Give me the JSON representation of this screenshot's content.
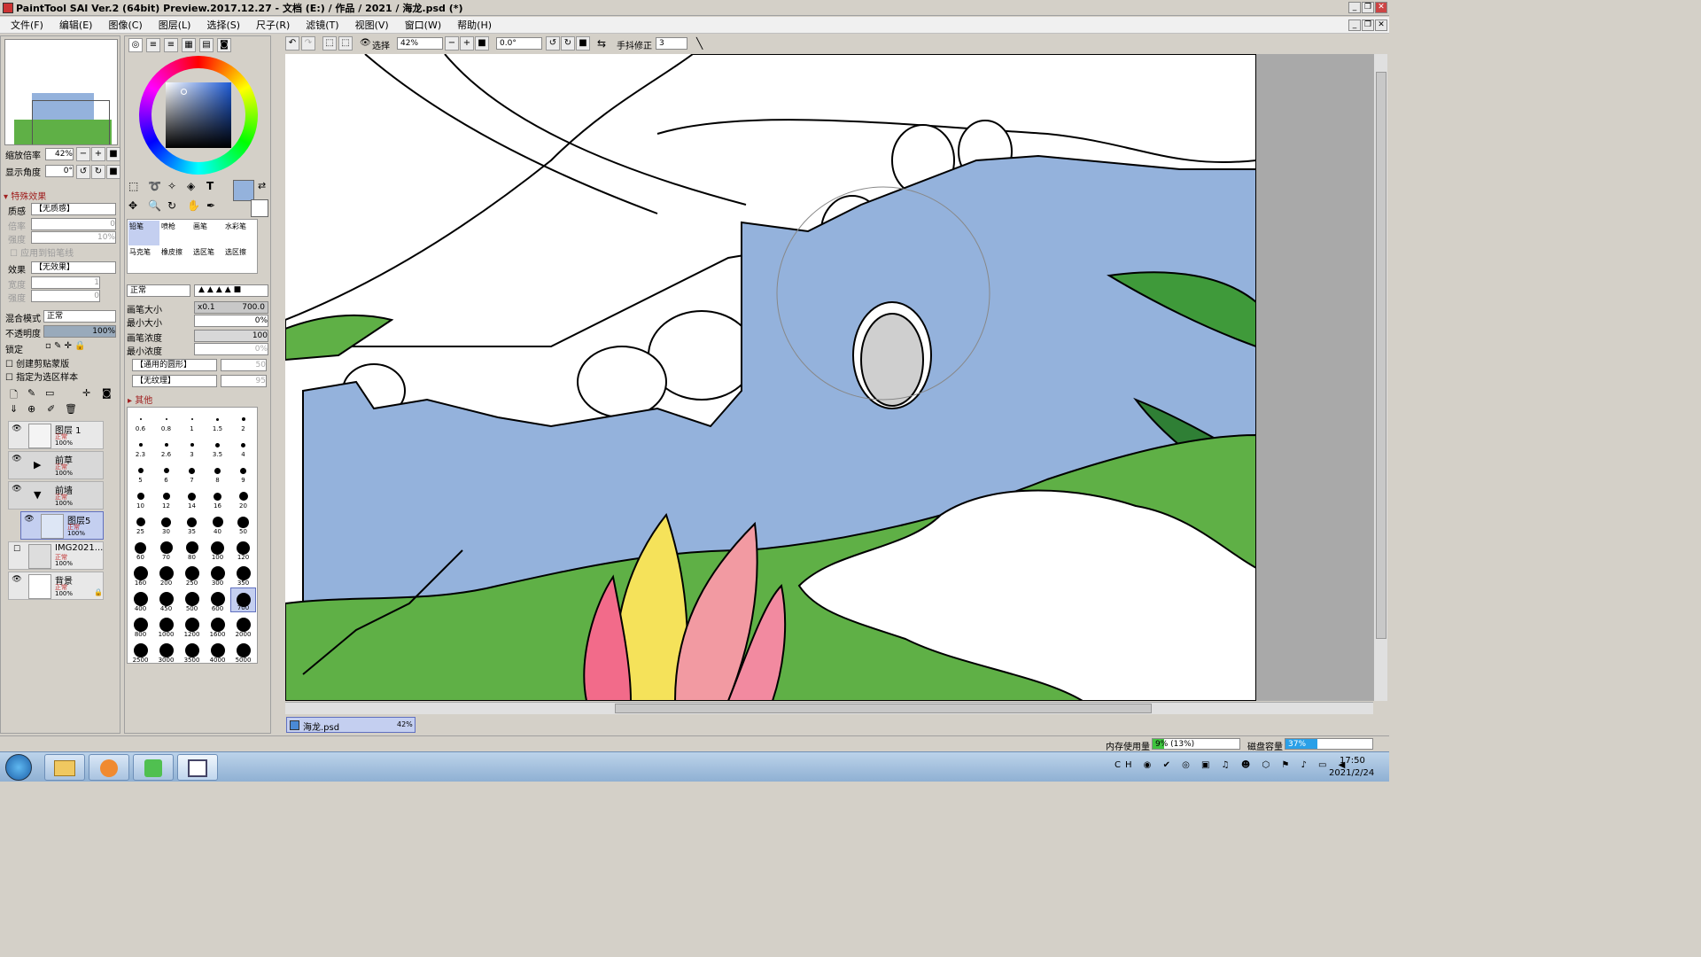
{
  "app": {
    "title": "PaintTool SAI Ver.2 (64bit) Preview.2017.12.27 - 文档 (E:) / 作品 / 2021 / 海龙.psd (*)"
  },
  "menu": [
    "文件(F)",
    "编辑(E)",
    "图像(C)",
    "图层(L)",
    "选择(S)",
    "尺子(R)",
    "滤镜(T)",
    "视图(V)",
    "窗口(W)",
    "帮助(H)"
  ],
  "toolbar": {
    "select_label": "选择",
    "zoom": "42%",
    "angle": "0.0°",
    "stabilizer_label": "手抖修正",
    "stabilizer_value": "3"
  },
  "navigator": {
    "zoom_label": "缩放倍率",
    "zoom_value": "42%",
    "angle_label": "显示角度",
    "angle_value": "0°"
  },
  "effects": {
    "header": "特殊效果",
    "texture_label": "质感",
    "texture_value": "【无质感】",
    "scale_label": "倍率",
    "scale_value": "0",
    "strength_label": "强度",
    "strength_value": "10%",
    "apply_label": "应用到铅笔线",
    "effect_label": "效果",
    "effect_value": "【无效果】",
    "width_label": "宽度",
    "width_value": "1",
    "intensity_label": "强度",
    "intensity_value": "0"
  },
  "layer_props": {
    "blend_label": "混合模式",
    "blend_value": "正常",
    "opacity_label": "不透明度",
    "opacity_value": "100%",
    "lock_label": "锁定",
    "clip_label": "创建剪贴蒙版",
    "sample_label": "指定为选区样本"
  },
  "layers": [
    {
      "name": "图层 1",
      "mode": "正常",
      "opacity": "100%"
    },
    {
      "name": "前草",
      "mode": "正常",
      "opacity": "100%"
    },
    {
      "name": "前墙",
      "mode": "正常",
      "opacity": "100%"
    },
    {
      "name": "图层5",
      "mode": "正常",
      "opacity": "100%"
    },
    {
      "name": "IMG2021...",
      "mode": "正常",
      "opacity": "100%"
    },
    {
      "name": "背景",
      "mode": "正常",
      "opacity": "100%"
    }
  ],
  "brush_tools": [
    [
      "铅笔",
      "喷枪",
      "画笔",
      "水彩笔"
    ],
    [
      "马克笔",
      "橡皮擦",
      "选区笔",
      "选区擦"
    ]
  ],
  "brush_props": {
    "mode": "正常",
    "size_label": "画笔大小",
    "size_mult": "x0.1",
    "size_value": "700.0",
    "min_size_label": "最小大小",
    "min_size_value": "0%",
    "density_label": "画笔浓度",
    "density_value": "100",
    "min_density_label": "最小浓度",
    "min_density_value": "0%",
    "shape_value": "【通用的圆形】",
    "shape_num": "50",
    "texture_value": "【无纹理】",
    "texture_num": "95",
    "other_label": "其他"
  },
  "brush_sizes": [
    "0.6",
    "0.8",
    "1",
    "1.5",
    "2",
    "2.3",
    "2.6",
    "3",
    "3.5",
    "4",
    "5",
    "6",
    "7",
    "8",
    "9",
    "10",
    "12",
    "14",
    "16",
    "20",
    "25",
    "30",
    "35",
    "40",
    "50",
    "60",
    "70",
    "80",
    "100",
    "120",
    "160",
    "200",
    "250",
    "300",
    "350",
    "400",
    "450",
    "500",
    "600",
    "700",
    "800",
    "1000",
    "1200",
    "1600",
    "2000",
    "2500",
    "3000",
    "3500",
    "4000",
    "5000"
  ],
  "canvas_tab": {
    "name": "海龙.psd",
    "zoom": "42%"
  },
  "status": {
    "mem_label": "内存使用量",
    "mem_value": "9% (13%)",
    "disk_label": "磁盘容量",
    "disk_value": "37%"
  },
  "clock": {
    "time": "17:50",
    "date": "2021/2/24"
  },
  "colors": {
    "accent": "#2a5aa8",
    "selected_color": "#94b2dc",
    "wall": "#94b2dc",
    "grass": "#5fb046"
  }
}
